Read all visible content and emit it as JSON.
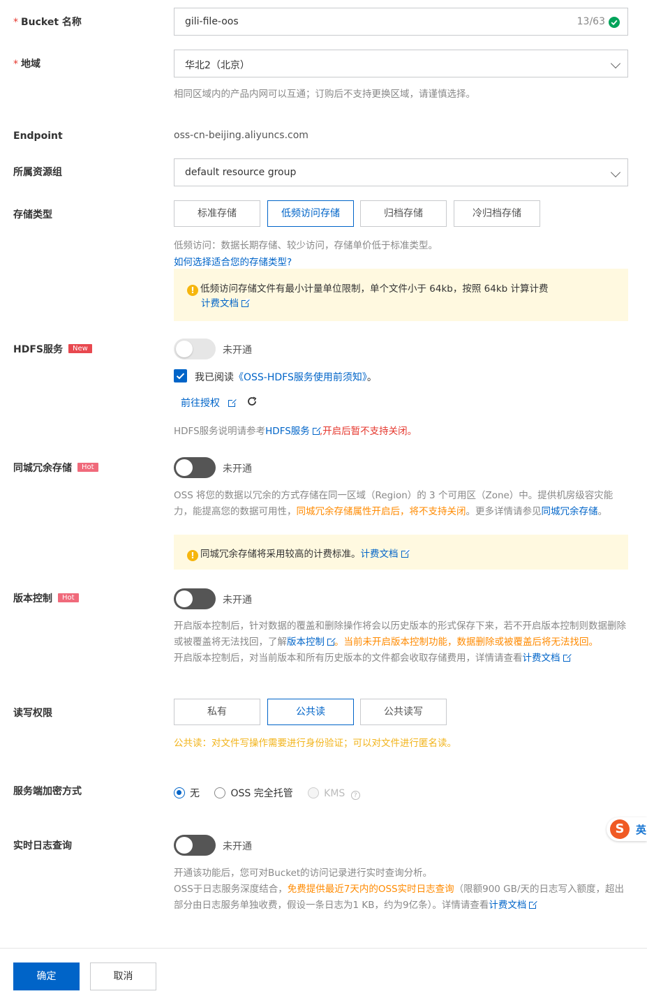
{
  "bucket": {
    "label": "Bucket 名称",
    "required_mark": "*",
    "value": "gili-file-oos",
    "counter": "13/63"
  },
  "region": {
    "label": "地域",
    "required_mark": "*",
    "value": "华北2（北京）",
    "hint": "相同区域内的产品内网可以互通；订购后不支持更换区域，请谨慎选择。"
  },
  "endpoint": {
    "label": "Endpoint",
    "value": "oss-cn-beijing.aliyuncs.com"
  },
  "resource_group": {
    "label": "所属资源组",
    "value": "default resource group"
  },
  "storage": {
    "label": "存储类型",
    "options": [
      "标准存储",
      "低频访问存储",
      "归档存储",
      "冷归档存储"
    ],
    "selected": "低频访问存储",
    "hint": "低频访问：数据长期存储、较少访问，存储单价低于标准类型。",
    "help_link": "如何选择适合您的存储类型?",
    "notice_text": "低频访问存储文件有最小计量单位限制，单个文件小于 64kb，按照 64kb 计算计费",
    "notice_link": "计费文档"
  },
  "hdfs": {
    "label": "HDFS服务",
    "badge": "New",
    "status": "未开通",
    "agree_prefix": "我已阅读",
    "agree_link": "《OSS-HDFS服务使用前须知》",
    "agree_suffix": "。",
    "auth_link": "前往授权",
    "note_prefix": "HDFS服务说明请参考",
    "note_link": "HDFS服务",
    "note_warn": ",开启后暂不支持关闭。"
  },
  "redundancy": {
    "label": "同城冗余存储",
    "badge": "Hot",
    "status": "未开通",
    "desc_1": "OSS 将您的数据以冗余的方式存储在同一区域（Region）的 3 个可用区（Zone）中。提供机房级容灾能力，能提高您的数据可用性，",
    "desc_warn": "同城冗余存储属性开启后，将不支持关闭",
    "desc_2": "。更多详情请参见",
    "desc_link": "同城冗余存储",
    "desc_end": "。",
    "notice_text": "同城冗余存储将采用较高的计费标准。",
    "notice_link": "计费文档"
  },
  "versioning": {
    "label": "版本控制",
    "badge": "Hot",
    "status": "未开通",
    "desc_1": "开启版本控制后，针对数据的覆盖和删除操作将会以历史版本的形式保存下来，若不开启版本控制则数据删除或被覆盖将无法找回，了解",
    "desc_link": "版本控制",
    "desc_warn": "。当前未开启版本控制功能，数据删除或被覆盖后将无法找回。",
    "desc_2": "开启版本控制后，对当前版本和所有历史版本的文件都会收取存储费用，详情请查看",
    "desc_link2": "计费文档"
  },
  "acl": {
    "label": "读写权限",
    "options": [
      "私有",
      "公共读",
      "公共读写"
    ],
    "selected": "公共读",
    "warning": "公共读：对文件写操作需要进行身份验证；可以对文件进行匿名读。"
  },
  "encryption": {
    "label": "服务端加密方式",
    "options": [
      "无",
      "OSS 完全托管",
      "KMS"
    ],
    "selected": "无",
    "disabled": "KMS"
  },
  "logging": {
    "label": "实时日志查询",
    "status": "未开通",
    "desc_1": "开通该功能后，您可对Bucket的访问记录进行实时查询分析。",
    "desc_2": "OSS于日志服务深度结合，",
    "desc_warn": "免费提供最近7天内的OSS实时日志查询",
    "desc_3": "（限额900 GB/天的日志写入额度，超出部分由日志服务单独收费，假设一条日志为1 KB，约为9亿条）。详情请查看",
    "desc_link": "计费文档"
  },
  "ime_badge": {
    "letter": "S",
    "text": "英"
  },
  "footer": {
    "confirm": "确定",
    "cancel": "取消"
  },
  "colors": {
    "primary": "#0064c8",
    "warning_bg": "#fff9e0",
    "warn_text": "#ff8a00",
    "error": "#e5362c",
    "success": "#00a35a"
  }
}
